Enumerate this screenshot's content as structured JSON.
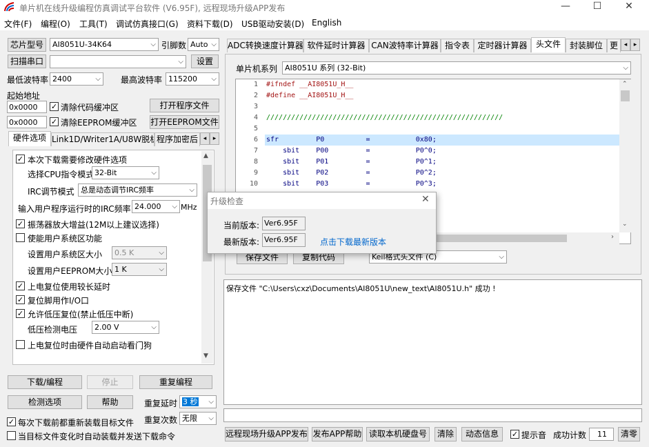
{
  "window": {
    "title": "单片机在线升级编程仿真调试平台软件 (V6.95F), 远程现场升级APP发布",
    "min": "—",
    "max": "☐",
    "close": "✕"
  },
  "menu": [
    "文件(F)",
    "编程(O)",
    "工具(T)",
    "调试仿真接口(G)",
    "资料下载(D)",
    "USB驱动安装(D)",
    "English"
  ],
  "chip": {
    "label": "芯片型号",
    "value": "AI8051U-34K64",
    "pins_label": "引脚数",
    "pins_value": "Auto"
  },
  "port": {
    "label": "扫描串口",
    "value": "",
    "settings": "设置"
  },
  "baud": {
    "min_label": "最低波特率",
    "min_value": "2400",
    "max_label": "最高波特率",
    "max_value": "115200"
  },
  "addr": {
    "label": "起始地址",
    "addr1": "0x0000",
    "clear_code": "清除代码缓冲区",
    "addr2": "0x0000",
    "clear_eeprom": "清除EEPROM缓冲区",
    "open_prog": "打开程序文件",
    "open_eeprom": "打开EEPROM文件"
  },
  "left_tabs": [
    "硬件选项",
    "Link1D/Writer1A/U8W脱机",
    "程序加密后"
  ],
  "hw": {
    "modify": "本次下载需要修改硬件选项",
    "cpu_mode_label": "选择CPU指令模式",
    "cpu_mode_value": "32-Bit",
    "irc_label": "IRC调节模式",
    "irc_value": "总是动态调节IRC频率",
    "freq_label": "输入用户程序运行时的IRC频率",
    "freq_value": "24.000",
    "freq_unit": "MHz",
    "osc": "振荡器放大增益(12M以上建议选择)",
    "sys_area": "使能用户系统区功能",
    "sys_size_label": "设置用户系统区大小",
    "sys_size_value": "0.5 K",
    "eeprom_size_label": "设置用户EEPROM大小",
    "eeprom_size_value": "1   K",
    "long_delay": "上电复位使用较长延时",
    "reset_io": "复位脚用作I/O口",
    "lvr": "允许低压复位(禁止低压中断)",
    "lv_label": "低压检测电压",
    "lv_value": "2.00 V",
    "wdt": "上电复位时由硬件自动启动看门狗"
  },
  "bottom_left": {
    "download": "下载/编程",
    "stop": "停止",
    "reprogram": "重复编程",
    "detect": "检测选项",
    "help": "帮助",
    "delay_label": "重复延时",
    "delay_value": "3 秒",
    "count_label": "重复次数",
    "count_value": "无限",
    "reload": "每次下载前都重新装载目标文件",
    "auto_send": "当目标文件变化时自动装载并发送下载命令"
  },
  "right_tabs": [
    "ADC转换速度计算器",
    "软件延时计算器",
    "CAN波特率计算器",
    "指令表",
    "定时器计算器",
    "头文件",
    "封装脚位",
    "更"
  ],
  "header_panel": {
    "mcu_label": "单片机系列",
    "mcu_value": "AI8051U 系列 (32-Bit)",
    "save": "保存文件",
    "copy": "复制代码",
    "format_value": "Keil格式头文件 (C)"
  },
  "code_lines": [
    {
      "n": "1",
      "t": "#ifndef __AI8051U_H__"
    },
    {
      "n": "2",
      "t": "#define __AI8051U_H__"
    },
    {
      "n": "3",
      "t": ""
    },
    {
      "n": "4",
      "t": "/////////////////////////////////////////////////////////"
    },
    {
      "n": "5",
      "t": ""
    },
    {
      "n": "6",
      "t": "sfr         P0          =           0x80;"
    },
    {
      "n": "7",
      "t": "    sbit    P00         =           P0^0;"
    },
    {
      "n": "8",
      "t": "    sbit    P01         =           P0^1;"
    },
    {
      "n": "9",
      "t": "    sbit    P02         =           P0^2;"
    },
    {
      "n": "10",
      "t": "    sbit    P03         =           P0^3;"
    }
  ],
  "dialog": {
    "title": "升级检查",
    "current_label": "当前版本:",
    "current_value": "Ver6.95F",
    "latest_label": "最新版本:",
    "latest_value": "Ver6.95F",
    "link": "点击下载最新版本"
  },
  "log": "保存文件 \"C:\\Users\\cxz\\Documents\\AI8051U\\new_text\\AI8051U.h\" 成功 !",
  "statusbar": {
    "publish": "远程现场升级APP发布",
    "publish_help": "发布APP帮助",
    "read_disk": "读取本机硬盘号",
    "clear": "清除",
    "dynamic": "动态信息",
    "beep": "提示音",
    "success_label": "成功计数",
    "success_value": "11",
    "zero": "清零"
  },
  "colors": {
    "accent": "#0066cc",
    "highlight_line": "#cce8ff",
    "selection": "#0078d7"
  }
}
